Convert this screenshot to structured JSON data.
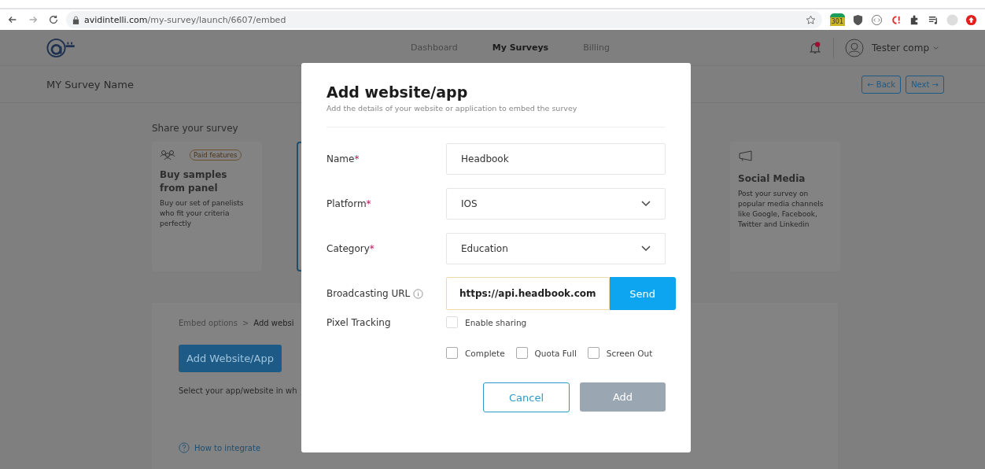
{
  "browser": {
    "url_host": "avidintelli.com",
    "url_path": "/my-survey/launch/6607/embed",
    "extension_badge": "301"
  },
  "header": {
    "nav": [
      {
        "label": "Dashboard",
        "selected": false
      },
      {
        "label": "My Surveys",
        "selected": true
      },
      {
        "label": "Billing",
        "selected": false
      }
    ],
    "user": "Tester comp"
  },
  "subheader": {
    "survey_name": "MY Survey Name",
    "back": "← Back",
    "next": "Next →"
  },
  "share": {
    "title": "Share your survey",
    "cards": [
      {
        "kind": "panel",
        "badge": "Paid features",
        "title": "Buy samples from panel",
        "text": "Buy our set of panelists who fit your criteria perfectly"
      },
      {
        "kind": "social",
        "title": "Social Media",
        "text": "Post your survey on popular media channels like Google, Facebook, Twitter and Linkedin"
      }
    ]
  },
  "embed": {
    "breadcrumb": [
      "Embed options",
      ">",
      "Add websi"
    ],
    "add_button": "Add Website/App",
    "instruction": "Select your app/website in wh",
    "help_link": "How to integrate"
  },
  "modal": {
    "title": "Add website/app",
    "subtitle": "Add the details of your website or application to embed the survey",
    "fields": [
      {
        "kind": "text",
        "label": "Name",
        "required_mark": "*",
        "value": "Headbook"
      },
      {
        "kind": "select",
        "label": "Platform",
        "required_mark": "*",
        "value": "IOS"
      },
      {
        "kind": "select",
        "label": "Category",
        "required_mark": "*",
        "value": "Education"
      },
      {
        "kind": "url",
        "label": "Broadcasting URL",
        "value": "https://api.headbook.com",
        "button": "Send"
      }
    ],
    "pixel_label": "Pixel Tracking",
    "enable_sharing": {
      "label": "Enable sharing",
      "checked": false
    },
    "events": [
      {
        "label": "Complete",
        "checked": false
      },
      {
        "label": "Quota Full",
        "checked": false
      },
      {
        "label": "Screen Out",
        "checked": false
      }
    ],
    "cancel": "Cancel",
    "add": "Add"
  }
}
